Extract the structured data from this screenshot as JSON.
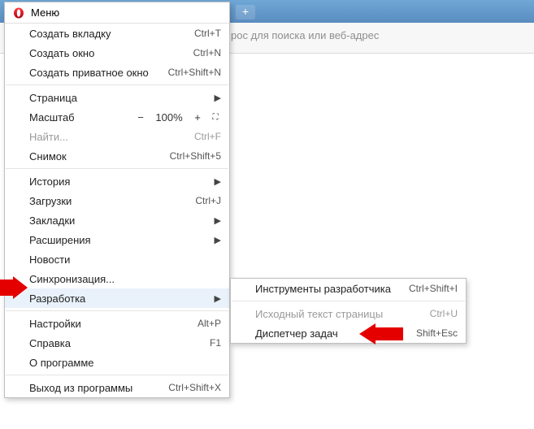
{
  "chrome": {
    "new_tab_glyph": "+",
    "address_placeholder": "рос для поиска или веб-адрес"
  },
  "menu": {
    "header": "Меню",
    "items": {
      "new_tab": {
        "label": "Создать вкладку",
        "shortcut": "Ctrl+T"
      },
      "new_win": {
        "label": "Создать окно",
        "shortcut": "Ctrl+N"
      },
      "new_priv": {
        "label": "Создать приватное окно",
        "shortcut": "Ctrl+Shift+N"
      },
      "page": {
        "label": "Страница"
      },
      "zoom": {
        "label": "Масштаб",
        "minus": "−",
        "value": "100%",
        "plus": "+"
      },
      "find": {
        "label": "Найти...",
        "shortcut": "Ctrl+F"
      },
      "snapshot": {
        "label": "Снимок",
        "shortcut": "Ctrl+Shift+5"
      },
      "history": {
        "label": "История"
      },
      "downloads": {
        "label": "Загрузки",
        "shortcut": "Ctrl+J"
      },
      "bookmarks": {
        "label": "Закладки"
      },
      "extensions": {
        "label": "Расширения"
      },
      "news": {
        "label": "Новости"
      },
      "sync": {
        "label": "Синхронизация..."
      },
      "developer": {
        "label": "Разработка"
      },
      "settings": {
        "label": "Настройки",
        "shortcut": "Alt+P"
      },
      "help": {
        "label": "Справка",
        "shortcut": "F1"
      },
      "about": {
        "label": "О программе"
      },
      "exit": {
        "label": "Выход из программы",
        "shortcut": "Ctrl+Shift+X"
      }
    }
  },
  "submenu": {
    "devtools": {
      "label": "Инструменты разработчика",
      "shortcut": "Ctrl+Shift+I"
    },
    "viewsource": {
      "label": "Исходный текст страницы",
      "shortcut": "Ctrl+U"
    },
    "taskmanager": {
      "label": "Диспетчер задач",
      "shortcut": "Shift+Esc"
    }
  },
  "glyphs": {
    "submenu_arrow": "▶",
    "fullscreen": "⛶"
  }
}
